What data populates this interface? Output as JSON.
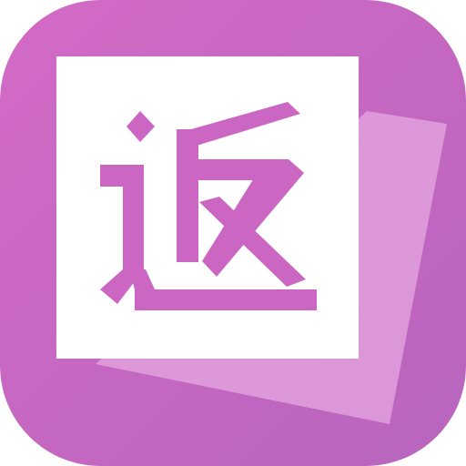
{
  "app": {
    "icon_name": "fan-return-app-icon",
    "glyph": "返"
  },
  "colors": {
    "bg_start": "#D36AC6",
    "bg_end": "#B865BD",
    "card": "#FFFFFF",
    "glyph": "#CB67C2",
    "back_card": "#E6A8E2",
    "back_card_opacity": "0.75"
  }
}
